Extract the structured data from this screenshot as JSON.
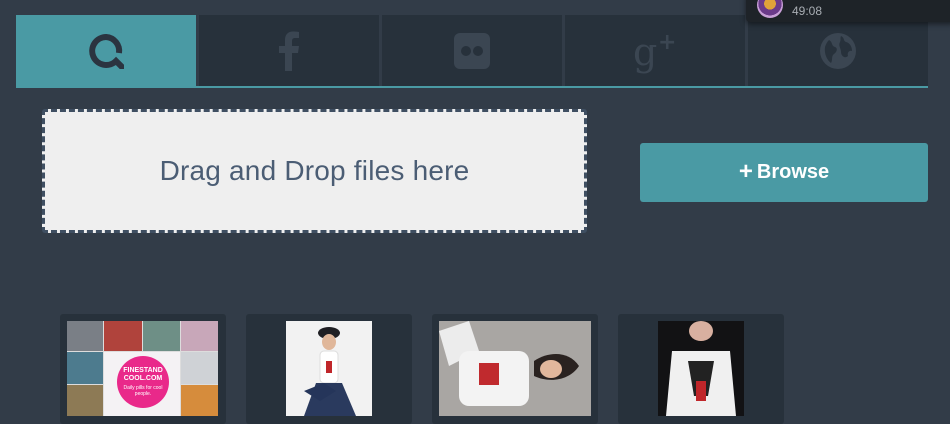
{
  "tabs": [
    {
      "name": "local",
      "icon": "q-logo-icon",
      "active": true
    },
    {
      "name": "facebook",
      "icon": "facebook-icon",
      "active": false
    },
    {
      "name": "flickr",
      "icon": "flickr-icon",
      "active": false
    },
    {
      "name": "google-plus",
      "icon": "google-plus-icon",
      "active": false
    },
    {
      "name": "web",
      "icon": "globe-icon",
      "active": false
    }
  ],
  "dropzone": {
    "text": "Drag and Drop files here"
  },
  "browse": {
    "icon": "plus-icon",
    "label": "Browse"
  },
  "notification": {
    "time": "49:08"
  },
  "thumbnails": [
    {
      "name": "collage",
      "badge_line1": "FINESTAND",
      "badge_line2": "COOL.COM",
      "badge_line3": "Daily pills for cool people."
    },
    {
      "name": "woman-sitting-beret"
    },
    {
      "name": "woman-lying-tshirt"
    },
    {
      "name": "woman-tshirt-print"
    }
  ],
  "colors": {
    "background": "#323c48",
    "accent": "#4a9aa4",
    "tab": "#27313b",
    "dropzone": "#efefef"
  }
}
